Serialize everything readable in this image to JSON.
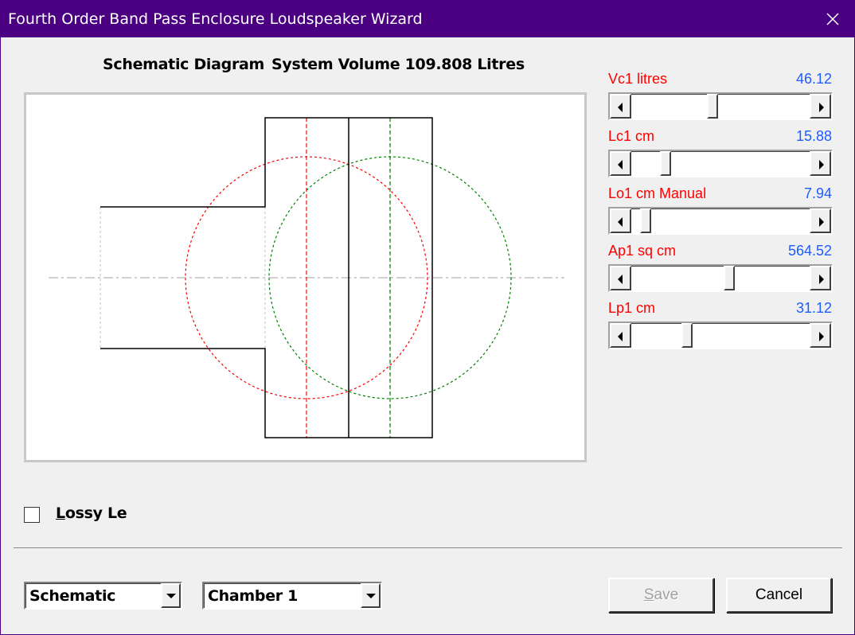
{
  "window": {
    "title": "Fourth Order Band Pass Enclosure Loudspeaker Wizard",
    "close_icon": "close-icon"
  },
  "diagram": {
    "label": "Schematic Diagram",
    "volume_label": "System Volume 109.808 Litres",
    "colors": {
      "outline": "#000000",
      "red": "#ff0000",
      "green": "#008000",
      "axis": "#c0c0c0"
    }
  },
  "params": [
    {
      "label": "Vc1  litres",
      "value": "46.12",
      "slider_fraction": 0.45
    },
    {
      "label": "Lc1  cm",
      "value": "15.88",
      "slider_fraction": 0.17
    },
    {
      "label": "Lo1  cm  Manual",
      "value": "7.94",
      "slider_fraction": 0.05
    },
    {
      "label": "Ap1  sq cm",
      "value": "564.52",
      "slider_fraction": 0.55
    },
    {
      "label": "Lp1  cm",
      "value": "31.12",
      "slider_fraction": 0.3
    }
  ],
  "lossy": {
    "label_prefix": "L",
    "label_rest": "ossy Le",
    "checked": false
  },
  "view_select": {
    "value": "Schematic"
  },
  "chamber_select": {
    "value": "Chamber 1"
  },
  "buttons": {
    "save_prefix": "S",
    "save_rest": "ave",
    "save_enabled": false,
    "cancel": "Cancel"
  },
  "colors": {
    "titlebar": "#4b0082",
    "label_red": "#ff0000",
    "value_blue": "#1e5cff"
  }
}
